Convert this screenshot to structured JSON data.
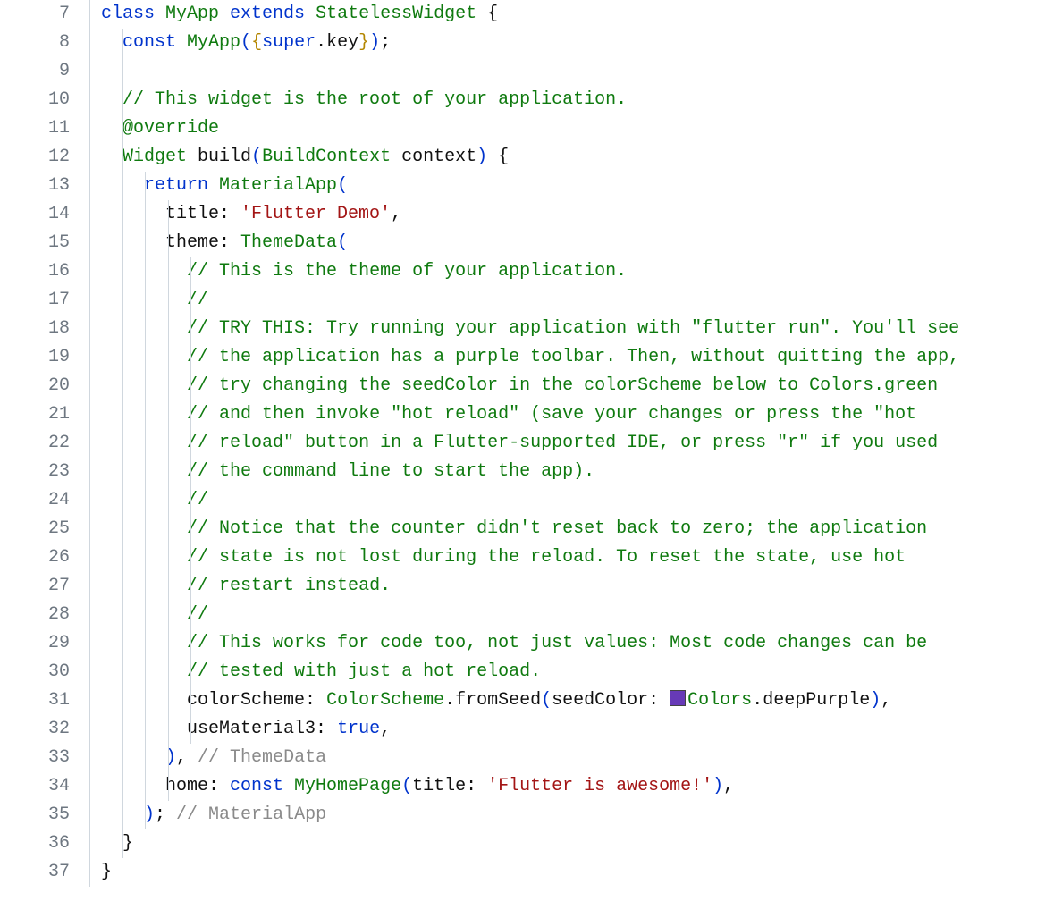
{
  "startLine": 7,
  "colors": {
    "swatch": "#673ab7"
  },
  "lines": [
    {
      "indent": 0,
      "segments": [
        {
          "t": "class ",
          "c": "tok-kw"
        },
        {
          "t": "MyApp ",
          "c": "tok-type"
        },
        {
          "t": "extends ",
          "c": "tok-kw"
        },
        {
          "t": "StatelessWidget ",
          "c": "tok-type"
        },
        {
          "t": "{",
          "c": "tok-punc"
        }
      ]
    },
    {
      "indent": 1,
      "segments": [
        {
          "t": "const ",
          "c": "tok-kw"
        },
        {
          "t": "MyApp",
          "c": "tok-type"
        },
        {
          "t": "(",
          "c": "tok-paren1"
        },
        {
          "t": "{",
          "c": "tok-paren2"
        },
        {
          "t": "super",
          "c": "tok-kw"
        },
        {
          "t": ".key",
          "c": "tok-ident"
        },
        {
          "t": "}",
          "c": "tok-paren2"
        },
        {
          "t": ")",
          "c": "tok-paren1"
        },
        {
          "t": ";",
          "c": "tok-punc"
        }
      ]
    },
    {
      "indent": 0,
      "segments": []
    },
    {
      "indent": 1,
      "segments": [
        {
          "t": "// This widget is the root of your application.",
          "c": "tok-comment"
        }
      ]
    },
    {
      "indent": 1,
      "segments": [
        {
          "t": "@override",
          "c": "tok-anno"
        }
      ]
    },
    {
      "indent": 1,
      "segments": [
        {
          "t": "Widget ",
          "c": "tok-type"
        },
        {
          "t": "build",
          "c": "tok-ident"
        },
        {
          "t": "(",
          "c": "tok-paren1"
        },
        {
          "t": "BuildContext ",
          "c": "tok-type"
        },
        {
          "t": "context",
          "c": "tok-ident"
        },
        {
          "t": ")",
          "c": "tok-paren1"
        },
        {
          "t": " {",
          "c": "tok-punc"
        }
      ]
    },
    {
      "indent": 2,
      "segments": [
        {
          "t": "return ",
          "c": "tok-kw"
        },
        {
          "t": "MaterialApp",
          "c": "tok-type"
        },
        {
          "t": "(",
          "c": "tok-paren1"
        }
      ]
    },
    {
      "indent": 3,
      "segments": [
        {
          "t": "title: ",
          "c": "tok-ident"
        },
        {
          "t": "'Flutter Demo'",
          "c": "tok-string"
        },
        {
          "t": ",",
          "c": "tok-punc"
        }
      ]
    },
    {
      "indent": 3,
      "segments": [
        {
          "t": "theme: ",
          "c": "tok-ident"
        },
        {
          "t": "ThemeData",
          "c": "tok-type"
        },
        {
          "t": "(",
          "c": "tok-paren1"
        }
      ]
    },
    {
      "indent": 4,
      "segments": [
        {
          "t": "// This is the theme of your application.",
          "c": "tok-comment"
        }
      ]
    },
    {
      "indent": 4,
      "segments": [
        {
          "t": "//",
          "c": "tok-comment"
        }
      ]
    },
    {
      "indent": 4,
      "segments": [
        {
          "t": "// TRY THIS: Try running your application with \"flutter run\". You'll see",
          "c": "tok-comment"
        }
      ]
    },
    {
      "indent": 4,
      "segments": [
        {
          "t": "// the application has a purple toolbar. Then, without quitting the app,",
          "c": "tok-comment"
        }
      ]
    },
    {
      "indent": 4,
      "segments": [
        {
          "t": "// try changing the seedColor in the colorScheme below to Colors.green",
          "c": "tok-comment"
        }
      ]
    },
    {
      "indent": 4,
      "segments": [
        {
          "t": "// and then invoke \"hot reload\" (save your changes or press the \"hot",
          "c": "tok-comment"
        }
      ]
    },
    {
      "indent": 4,
      "segments": [
        {
          "t": "// reload\" button in a Flutter-supported IDE, or press \"r\" if you used",
          "c": "tok-comment"
        }
      ]
    },
    {
      "indent": 4,
      "segments": [
        {
          "t": "// the command line to start the app).",
          "c": "tok-comment"
        }
      ]
    },
    {
      "indent": 4,
      "segments": [
        {
          "t": "//",
          "c": "tok-comment"
        }
      ]
    },
    {
      "indent": 4,
      "segments": [
        {
          "t": "// Notice that the counter didn't reset back to zero; the application",
          "c": "tok-comment"
        }
      ]
    },
    {
      "indent": 4,
      "segments": [
        {
          "t": "// state is not lost during the reload. To reset the state, use hot",
          "c": "tok-comment"
        }
      ]
    },
    {
      "indent": 4,
      "segments": [
        {
          "t": "// restart instead.",
          "c": "tok-comment"
        }
      ]
    },
    {
      "indent": 4,
      "segments": [
        {
          "t": "//",
          "c": "tok-comment"
        }
      ]
    },
    {
      "indent": 4,
      "segments": [
        {
          "t": "// This works for code too, not just values: Most code changes can be",
          "c": "tok-comment"
        }
      ]
    },
    {
      "indent": 4,
      "segments": [
        {
          "t": "// tested with just a hot reload.",
          "c": "tok-comment"
        }
      ]
    },
    {
      "indent": 4,
      "segments": [
        {
          "t": "colorScheme: ",
          "c": "tok-ident"
        },
        {
          "t": "ColorScheme",
          "c": "tok-type"
        },
        {
          "t": ".",
          "c": "tok-punc"
        },
        {
          "t": "fromSeed",
          "c": "tok-ident"
        },
        {
          "t": "(",
          "c": "tok-paren1"
        },
        {
          "t": "seedColor: ",
          "c": "tok-ident"
        },
        {
          "swatch": true
        },
        {
          "t": "Colors",
          "c": "tok-type"
        },
        {
          "t": ".deepPurple",
          "c": "tok-ident"
        },
        {
          "t": ")",
          "c": "tok-paren1"
        },
        {
          "t": ",",
          "c": "tok-punc"
        }
      ]
    },
    {
      "indent": 4,
      "segments": [
        {
          "t": "useMaterial3: ",
          "c": "tok-ident"
        },
        {
          "t": "true",
          "c": "tok-bool"
        },
        {
          "t": ",",
          "c": "tok-punc"
        }
      ]
    },
    {
      "indent": 3,
      "segments": [
        {
          "t": ")",
          "c": "tok-paren1"
        },
        {
          "t": ",",
          "c": "tok-punc"
        },
        {
          "t": " // ThemeData",
          "c": "tok-ghost"
        }
      ]
    },
    {
      "indent": 3,
      "segments": [
        {
          "t": "home: ",
          "c": "tok-ident"
        },
        {
          "t": "const ",
          "c": "tok-kw"
        },
        {
          "t": "MyHomePage",
          "c": "tok-type"
        },
        {
          "t": "(",
          "c": "tok-paren1"
        },
        {
          "t": "title: ",
          "c": "tok-ident"
        },
        {
          "t": "'Flutter is awesome!'",
          "c": "tok-string"
        },
        {
          "t": ")",
          "c": "tok-paren1"
        },
        {
          "t": ",",
          "c": "tok-punc"
        }
      ]
    },
    {
      "indent": 2,
      "segments": [
        {
          "t": ")",
          "c": "tok-paren1"
        },
        {
          "t": ";",
          "c": "tok-punc"
        },
        {
          "t": " // MaterialApp",
          "c": "tok-ghost"
        }
      ]
    },
    {
      "indent": 1,
      "segments": [
        {
          "t": "}",
          "c": "tok-punc"
        }
      ]
    },
    {
      "indent": 0,
      "segments": [
        {
          "t": "}",
          "c": "tok-punc"
        }
      ]
    }
  ]
}
